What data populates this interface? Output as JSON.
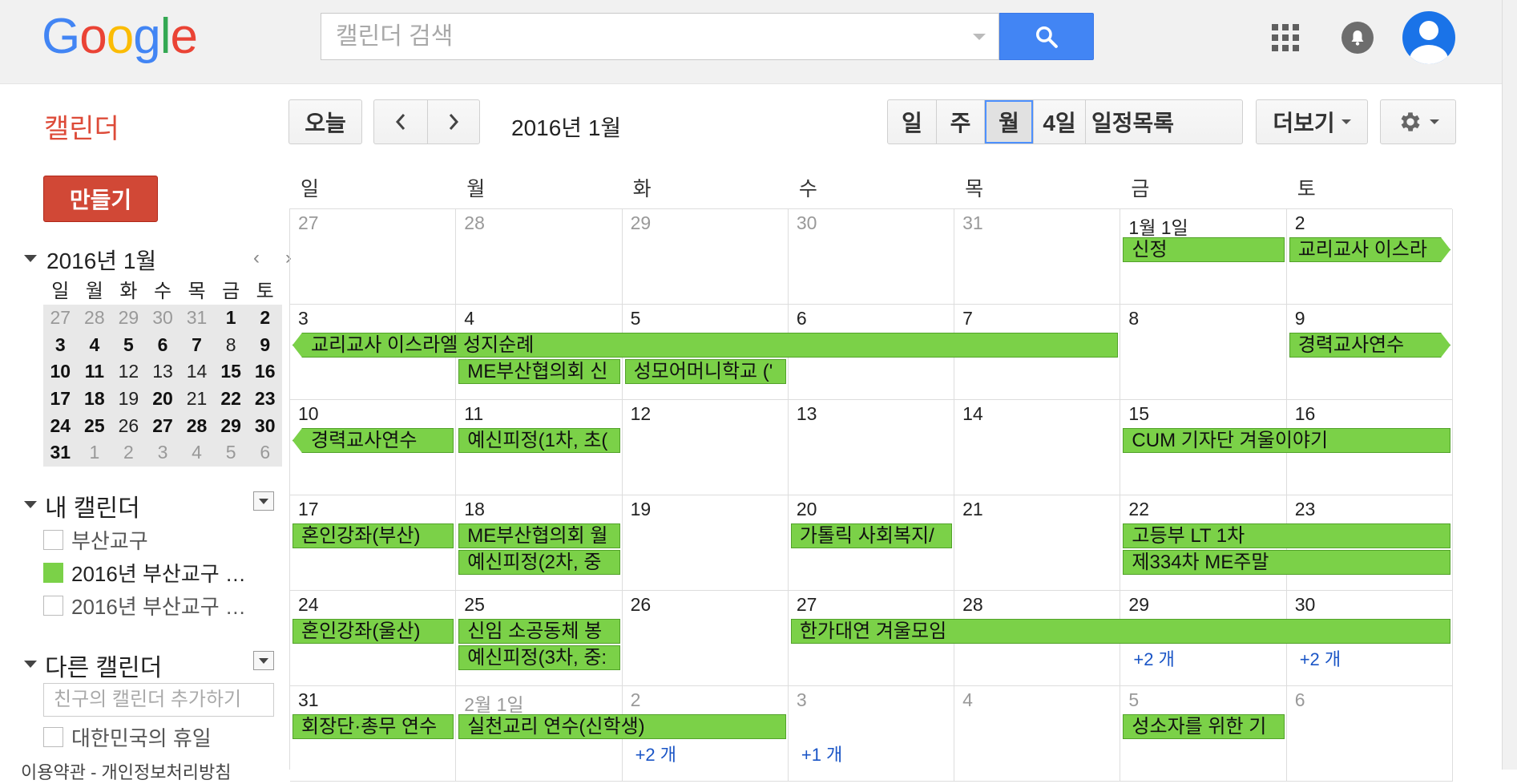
{
  "header": {
    "logo_letters": [
      {
        "ch": "G",
        "color": "#4285f4"
      },
      {
        "ch": "o",
        "color": "#ea4335"
      },
      {
        "ch": "o",
        "color": "#fbbc05"
      },
      {
        "ch": "g",
        "color": "#4285f4"
      },
      {
        "ch": "l",
        "color": "#34a853"
      },
      {
        "ch": "e",
        "color": "#ea4335"
      }
    ],
    "search_placeholder": "캘린더 검색",
    "app_title": "캘린더"
  },
  "toolbar": {
    "today": "오늘",
    "current_period": "2016년 1월",
    "views": [
      {
        "label": "일",
        "active": false
      },
      {
        "label": "주",
        "active": false
      },
      {
        "label": "월",
        "active": true
      },
      {
        "label": "4일",
        "active": false
      },
      {
        "label": "일정목록",
        "active": false
      }
    ],
    "more": "더보기"
  },
  "sidebar": {
    "create": "만들기",
    "mini_cal_title": "2016년 1월",
    "weekdays": [
      "일",
      "월",
      "화",
      "수",
      "목",
      "금",
      "토"
    ],
    "mini_weeks": [
      [
        {
          "d": "27",
          "s": "oth"
        },
        {
          "d": "28",
          "s": "oth"
        },
        {
          "d": "29",
          "s": "oth"
        },
        {
          "d": "30",
          "s": "oth"
        },
        {
          "d": "31",
          "s": "oth"
        },
        {
          "d": "1",
          "s": "bold"
        },
        {
          "d": "2",
          "s": "bold"
        }
      ],
      [
        {
          "d": "3",
          "s": "bold"
        },
        {
          "d": "4",
          "s": "bold"
        },
        {
          "d": "5",
          "s": "bold"
        },
        {
          "d": "6",
          "s": "bold"
        },
        {
          "d": "7",
          "s": "bold"
        },
        {
          "d": "8",
          "s": "reg"
        },
        {
          "d": "9",
          "s": "bold"
        }
      ],
      [
        {
          "d": "10",
          "s": "bold"
        },
        {
          "d": "11",
          "s": "bold"
        },
        {
          "d": "12",
          "s": "reg"
        },
        {
          "d": "13",
          "s": "reg"
        },
        {
          "d": "14",
          "s": "reg"
        },
        {
          "d": "15",
          "s": "bold"
        },
        {
          "d": "16",
          "s": "bold"
        }
      ],
      [
        {
          "d": "17",
          "s": "bold"
        },
        {
          "d": "18",
          "s": "bold"
        },
        {
          "d": "19",
          "s": "reg"
        },
        {
          "d": "20",
          "s": "bold"
        },
        {
          "d": "21",
          "s": "reg"
        },
        {
          "d": "22",
          "s": "bold"
        },
        {
          "d": "23",
          "s": "bold"
        }
      ],
      [
        {
          "d": "24",
          "s": "bold"
        },
        {
          "d": "25",
          "s": "bold"
        },
        {
          "d": "26",
          "s": "reg"
        },
        {
          "d": "27",
          "s": "bold"
        },
        {
          "d": "28",
          "s": "bold"
        },
        {
          "d": "29",
          "s": "bold"
        },
        {
          "d": "30",
          "s": "bold"
        }
      ],
      [
        {
          "d": "31",
          "s": "bold"
        },
        {
          "d": "1",
          "s": "oth"
        },
        {
          "d": "2",
          "s": "oth"
        },
        {
          "d": "3",
          "s": "oth"
        },
        {
          "d": "4",
          "s": "oth"
        },
        {
          "d": "5",
          "s": "oth"
        },
        {
          "d": "6",
          "s": "oth"
        }
      ]
    ],
    "my_calendars_title": "내 캘린더",
    "my_calendars": [
      {
        "label": "부산교구",
        "checked": false
      },
      {
        "label": "2016년 부산교구 …",
        "checked": true
      },
      {
        "label": "2016년 부산교구 …",
        "checked": false
      }
    ],
    "other_calendars_title": "다른 캘린더",
    "add_friend_placeholder": "친구의 캘린더 추가하기",
    "other_calendars": [
      {
        "label": "대한민국의 휴일",
        "checked": false
      }
    ],
    "footer": "이용약관 - 개인정보처리방침"
  },
  "month": {
    "weekday_headers": [
      "일",
      "월",
      "화",
      "수",
      "목",
      "금",
      "토"
    ],
    "weeks": [
      {
        "days": [
          {
            "label": "27",
            "other": true
          },
          {
            "label": "28",
            "other": true
          },
          {
            "label": "29",
            "other": true
          },
          {
            "label": "30",
            "other": true
          },
          {
            "label": "31",
            "other": true
          },
          {
            "label": "1월 1일",
            "other": false
          },
          {
            "label": "2",
            "other": false
          }
        ],
        "events": [
          {
            "title": "신정",
            "start": 5,
            "span": 1,
            "lane": 0,
            "cl": false,
            "cr": false
          },
          {
            "title": "교리교사 이스라",
            "start": 6,
            "span": 1,
            "lane": 0,
            "cl": false,
            "cr": true
          }
        ],
        "more": []
      },
      {
        "days": [
          {
            "label": "3",
            "other": false
          },
          {
            "label": "4",
            "other": false
          },
          {
            "label": "5",
            "other": false
          },
          {
            "label": "6",
            "other": false
          },
          {
            "label": "7",
            "other": false
          },
          {
            "label": "8",
            "other": false
          },
          {
            "label": "9",
            "other": false
          }
        ],
        "events": [
          {
            "title": "교리교사 이스라엘 성지순례",
            "start": 0,
            "span": 5,
            "lane": 0,
            "cl": true,
            "cr": false
          },
          {
            "title": "경력교사연수",
            "start": 6,
            "span": 1,
            "lane": 0,
            "cl": false,
            "cr": true
          },
          {
            "title": "ME부산협의회 신",
            "start": 1,
            "span": 1,
            "lane": 1,
            "cl": false,
            "cr": false
          },
          {
            "title": "성모어머니학교 ('",
            "start": 2,
            "span": 1,
            "lane": 1,
            "cl": false,
            "cr": false
          }
        ],
        "more": []
      },
      {
        "days": [
          {
            "label": "10",
            "other": false
          },
          {
            "label": "11",
            "other": false
          },
          {
            "label": "12",
            "other": false
          },
          {
            "label": "13",
            "other": false
          },
          {
            "label": "14",
            "other": false
          },
          {
            "label": "15",
            "other": false
          },
          {
            "label": "16",
            "other": false
          }
        ],
        "events": [
          {
            "title": "경력교사연수",
            "start": 0,
            "span": 1,
            "lane": 0,
            "cl": true,
            "cr": false
          },
          {
            "title": "예신피정(1차, 초(",
            "start": 1,
            "span": 1,
            "lane": 0,
            "cl": false,
            "cr": false
          },
          {
            "title": "CUM 기자단 겨울이야기",
            "start": 5,
            "span": 2,
            "lane": 0,
            "cl": false,
            "cr": false
          }
        ],
        "more": []
      },
      {
        "days": [
          {
            "label": "17",
            "other": false
          },
          {
            "label": "18",
            "other": false
          },
          {
            "label": "19",
            "other": false
          },
          {
            "label": "20",
            "other": false
          },
          {
            "label": "21",
            "other": false
          },
          {
            "label": "22",
            "other": false
          },
          {
            "label": "23",
            "other": false
          }
        ],
        "events": [
          {
            "title": "혼인강좌(부산)",
            "start": 0,
            "span": 1,
            "lane": 0,
            "cl": false,
            "cr": false
          },
          {
            "title": "ME부산협의회 월",
            "start": 1,
            "span": 1,
            "lane": 0,
            "cl": false,
            "cr": false
          },
          {
            "title": "가톨릭 사회복지/",
            "start": 3,
            "span": 1,
            "lane": 0,
            "cl": false,
            "cr": false
          },
          {
            "title": "고등부 LT 1차",
            "start": 5,
            "span": 2,
            "lane": 0,
            "cl": false,
            "cr": false
          },
          {
            "title": "예신피정(2차, 중",
            "start": 1,
            "span": 1,
            "lane": 1,
            "cl": false,
            "cr": false
          },
          {
            "title": "제334차 ME주말",
            "start": 5,
            "span": 2,
            "lane": 1,
            "cl": false,
            "cr": false
          }
        ],
        "more": []
      },
      {
        "days": [
          {
            "label": "24",
            "other": false
          },
          {
            "label": "25",
            "other": false
          },
          {
            "label": "26",
            "other": false
          },
          {
            "label": "27",
            "other": false
          },
          {
            "label": "28",
            "other": false
          },
          {
            "label": "29",
            "other": false
          },
          {
            "label": "30",
            "other": false
          }
        ],
        "events": [
          {
            "title": "혼인강좌(울산)",
            "start": 0,
            "span": 1,
            "lane": 0,
            "cl": false,
            "cr": false
          },
          {
            "title": "신임 소공동체 봉",
            "start": 1,
            "span": 1,
            "lane": 0,
            "cl": false,
            "cr": false
          },
          {
            "title": "한가대연 겨울모임",
            "start": 3,
            "span": 4,
            "lane": 0,
            "cl": false,
            "cr": false
          },
          {
            "title": "예신피정(3차, 중:",
            "start": 1,
            "span": 1,
            "lane": 1,
            "cl": false,
            "cr": false
          }
        ],
        "more": [
          {
            "col": 5,
            "text": "+2 개"
          },
          {
            "col": 6,
            "text": "+2 개"
          }
        ]
      },
      {
        "days": [
          {
            "label": "31",
            "other": false
          },
          {
            "label": "2월 1일",
            "other": true
          },
          {
            "label": "2",
            "other": true
          },
          {
            "label": "3",
            "other": true
          },
          {
            "label": "4",
            "other": true
          },
          {
            "label": "5",
            "other": true
          },
          {
            "label": "6",
            "other": true
          }
        ],
        "events": [
          {
            "title": "회장단·총무 연수",
            "start": 0,
            "span": 1,
            "lane": 0,
            "cl": false,
            "cr": false
          },
          {
            "title": "실천교리 연수(신학생)",
            "start": 1,
            "span": 2,
            "lane": 0,
            "cl": false,
            "cr": false
          },
          {
            "title": "성소자를 위한 기",
            "start": 5,
            "span": 1,
            "lane": 0,
            "cl": false,
            "cr": false
          }
        ],
        "more": [
          {
            "col": 2,
            "text": "+2 개"
          },
          {
            "col": 3,
            "text": "+1 개"
          }
        ]
      }
    ]
  },
  "colors": {
    "event": "#7bd148",
    "brand_red": "#dd4b39",
    "search_blue": "#4285f4",
    "more_link": "#1a55c6"
  }
}
